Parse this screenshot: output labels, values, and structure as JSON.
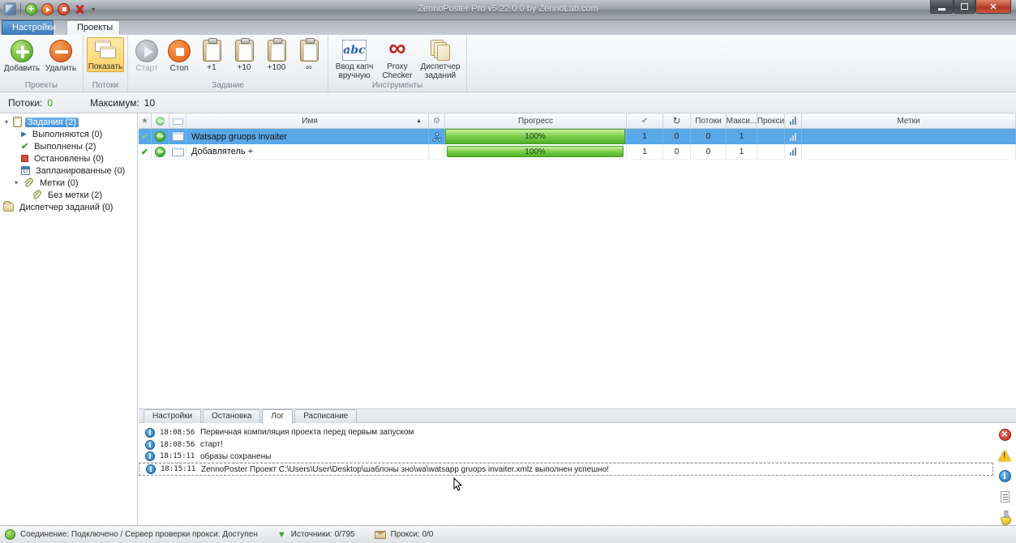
{
  "window": {
    "title": "ZennoPoster Pro v5.22.0.0 by ZennoLab.com"
  },
  "ribbon": {
    "tabs": [
      {
        "label": "Настройки"
      },
      {
        "label": "Проекты"
      }
    ],
    "groups": [
      {
        "label": "Проекты",
        "buttons": [
          {
            "label": "Добавить"
          },
          {
            "label": "Удалить"
          }
        ]
      },
      {
        "label": "Потоки",
        "buttons": [
          {
            "label": "Показать"
          }
        ]
      },
      {
        "label": "Задание",
        "buttons": [
          {
            "label": "Старт"
          },
          {
            "label": "Стоп"
          },
          {
            "label": "+1"
          },
          {
            "label": "+10"
          },
          {
            "label": "+100"
          },
          {
            "label": "∞"
          }
        ]
      },
      {
        "label": "Инструменты",
        "buttons": [
          {
            "label": "Ввод капч вручную"
          },
          {
            "label": "Proxy Checker"
          },
          {
            "label": "Диспетчер заданий"
          }
        ]
      }
    ]
  },
  "threads_bar": {
    "threads_label": "Потоки:",
    "threads_value": "0",
    "max_label": "Максимум:",
    "max_value": "10"
  },
  "tree": {
    "items": [
      {
        "label": "Задания (2)"
      },
      {
        "label": "Выполняются (0)"
      },
      {
        "label": "Выполнены (2)"
      },
      {
        "label": "Остановлены (0)"
      },
      {
        "label": "Запланированные (0)"
      },
      {
        "label": "Метки (0)"
      },
      {
        "label": "Без метки (2)"
      },
      {
        "label": "Диспетчер заданий (0)"
      }
    ]
  },
  "table": {
    "columns": {
      "name": "Имя",
      "progress": "Прогресс",
      "threads": "Потоки",
      "max": "Макси...",
      "proxy": "Прокси",
      "labels": "Метки"
    },
    "header_icons": {
      "star": "★",
      "restart": "↻",
      "check": "✔",
      "gear": "⚙",
      "sort_asc": "▲"
    },
    "rows": [
      {
        "name": "Watsapp gruops invaiter",
        "progress": "100%",
        "completed": "1",
        "restarts": "0",
        "threads": "0",
        "max_threads": "1",
        "proxy": "",
        "labels": ""
      },
      {
        "name": "Добавлятель +",
        "progress": "100%",
        "completed": "1",
        "restarts": "0",
        "threads": "0",
        "max_threads": "1",
        "proxy": "",
        "labels": ""
      }
    ]
  },
  "log": {
    "tabs": [
      {
        "label": "Настройки"
      },
      {
        "label": "Остановка"
      },
      {
        "label": "Лог"
      },
      {
        "label": "Расписание"
      }
    ],
    "entries": [
      {
        "time": "18:08:56",
        "message": "Первичная компиляция проекта перед первым запуском"
      },
      {
        "time": "18:08:56",
        "message": "старт!"
      },
      {
        "time": "18:15:11",
        "message": "образы сохранены"
      },
      {
        "time": "18:15:11",
        "message": "ZennoPoster Проект C:\\Users\\User\\Desktop\\шаблоны зно\\wa\\watsapp gruops invaiter.xmlz выполнен успешно!"
      }
    ]
  },
  "status_bar": {
    "connection": "Соединение: Подключено / Сервер проверки прокси: Доступен",
    "sources": "Источники: 0/795",
    "proxy": "Прокси: 0/0"
  },
  "colors": {
    "selection_blue": "#5aa7e6",
    "progress_green": "#4fae27",
    "tab_blue": "#3a78b8",
    "highlight_yellow": "#fbd268"
  }
}
